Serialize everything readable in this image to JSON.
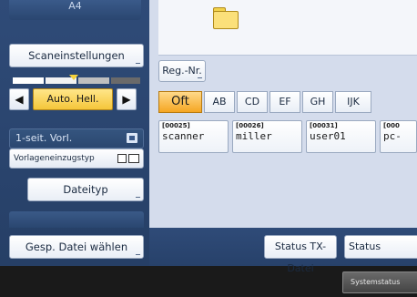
{
  "left_panel": {
    "paper_size": "A4",
    "scan_settings_label": "Scaneinstellungen",
    "density": {
      "left_arrow": "◀",
      "auto_label": "Auto. Hell.",
      "right_arrow": "▶"
    },
    "sides_label": "1-seit. Vorl.",
    "orientation_label": "Vorlageneinzugstyp",
    "file_type_label": "Dateityp",
    "select_stored_label": "Gesp. Datei wählen"
  },
  "right_panel": {
    "reg_no_label": "Reg.-Nr.",
    "tabs": [
      {
        "label": "Oft",
        "active": true
      },
      {
        "label": "AB",
        "active": false
      },
      {
        "label": "CD",
        "active": false
      },
      {
        "label": "EF",
        "active": false
      },
      {
        "label": "GH",
        "active": false
      },
      {
        "label": "IJK",
        "active": false
      }
    ],
    "destinations": [
      {
        "id": "[00025]",
        "name": "scanner"
      },
      {
        "id": "[00026]",
        "name": "miller"
      },
      {
        "id": "[00031]",
        "name": "user01"
      },
      {
        "id": "[000",
        "name": "pc-"
      }
    ],
    "status_tx_label": "Status TX-Datei",
    "status_label": "Status"
  },
  "footer": {
    "system_status_label": "Systemstatus"
  },
  "colors": {
    "panel_blue": "#2f4b78",
    "active_tab": "#f5a623",
    "auto_button": "#f5c63a",
    "content_bg": "#d4dcec"
  }
}
